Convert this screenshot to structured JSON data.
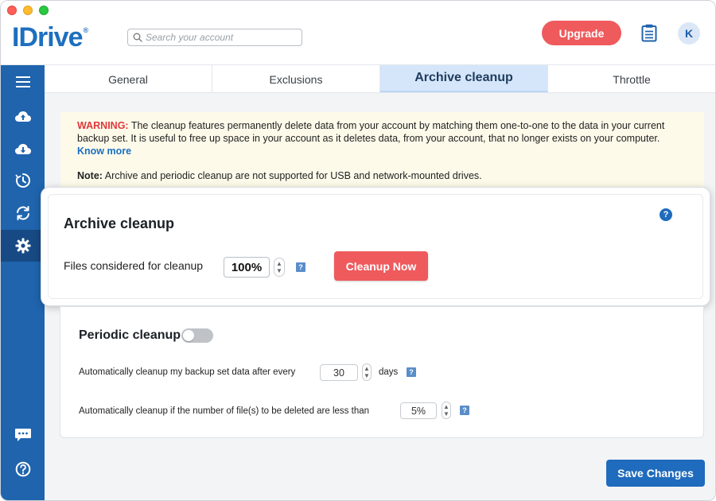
{
  "app": {
    "logo_text": "IDrive",
    "logo_registered": "®",
    "search_placeholder": "Search your account",
    "upgrade_label": "Upgrade",
    "avatar_initial": "K"
  },
  "sidebar": {
    "items": [
      {
        "icon": "menu-icon"
      },
      {
        "icon": "cloud-upload-icon"
      },
      {
        "icon": "cloud-download-icon"
      },
      {
        "icon": "clock-icon"
      },
      {
        "icon": "sync-icon"
      },
      {
        "icon": "gear-icon",
        "active": true
      },
      {
        "icon": "chat-icon"
      },
      {
        "icon": "help-icon"
      }
    ]
  },
  "tabs": [
    {
      "label": "General"
    },
    {
      "label": "Exclusions"
    },
    {
      "label": "Archive cleanup",
      "active": true
    },
    {
      "label": "Throttle"
    }
  ],
  "warning": {
    "label": "WARNING:",
    "text": " The cleanup features permanently delete data from your account by matching them one-to-one to the data in your current backup set. It is useful to free up space in your account as it deletes data, from your account, that no longer exists on your computer. ",
    "link": "Know more",
    "note_label": "Note:",
    "note_text": " Archive and periodic cleanup are not supported for USB and network-mounted drives."
  },
  "archive": {
    "title": "Archive cleanup",
    "help": "?",
    "files_label": "Files considered for cleanup",
    "percent_value": "100%",
    "q_mark": "?",
    "cleanup_button": "Cleanup Now"
  },
  "periodic": {
    "title": "Periodic cleanup",
    "enabled": false,
    "row1_label": "Automatically cleanup my backup set data after every",
    "row1_value": "30",
    "row1_unit": "days",
    "row2_label": "Automatically cleanup if the number of file(s) to be deleted are less than",
    "row2_value": "5%",
    "q_mark": "?"
  },
  "footer": {
    "save_button": "Save Changes"
  },
  "colors": {
    "brand_blue": "#1f64ad",
    "accent_red": "#ef5a5d",
    "save_blue": "#1f6bbd",
    "warning_red": "#e0383b",
    "tab_active_bg": "#d5e6fb",
    "warning_bg": "#fdfaea"
  }
}
